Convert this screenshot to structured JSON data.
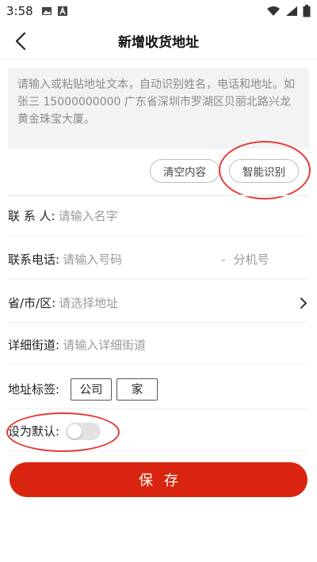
{
  "status_bar": {
    "time": "3:58"
  },
  "header": {
    "title": "新增收货地址"
  },
  "paste_box": {
    "placeholder": "请输入或粘贴地址文本，自动识别姓名，电话和地址。如张三 15000000000 广东省深圳市罗湖区贝丽北路兴龙黄金珠宝大厦。"
  },
  "actions": {
    "clear_label": "清空内容",
    "recognize_label": "智能识别"
  },
  "form": {
    "name": {
      "label": "联 系 人:",
      "placeholder": "请输入名字"
    },
    "phone": {
      "label": "联系电话:",
      "placeholder": "请输入号码",
      "dash": "-",
      "ext_placeholder": "分机号"
    },
    "region": {
      "label": "省/市/区:",
      "placeholder": "请选择地址"
    },
    "street": {
      "label": "详细街道:",
      "placeholder": "请输入详细街道"
    },
    "tag": {
      "label": "地址标签:",
      "options": [
        "公司",
        "家"
      ]
    },
    "default": {
      "label": "设为默认:",
      "enabled": false
    }
  },
  "save_label": "保存",
  "colors": {
    "accent": "#d9250f",
    "annotation": "#e53935",
    "paste_bg": "#f1f3f4"
  }
}
